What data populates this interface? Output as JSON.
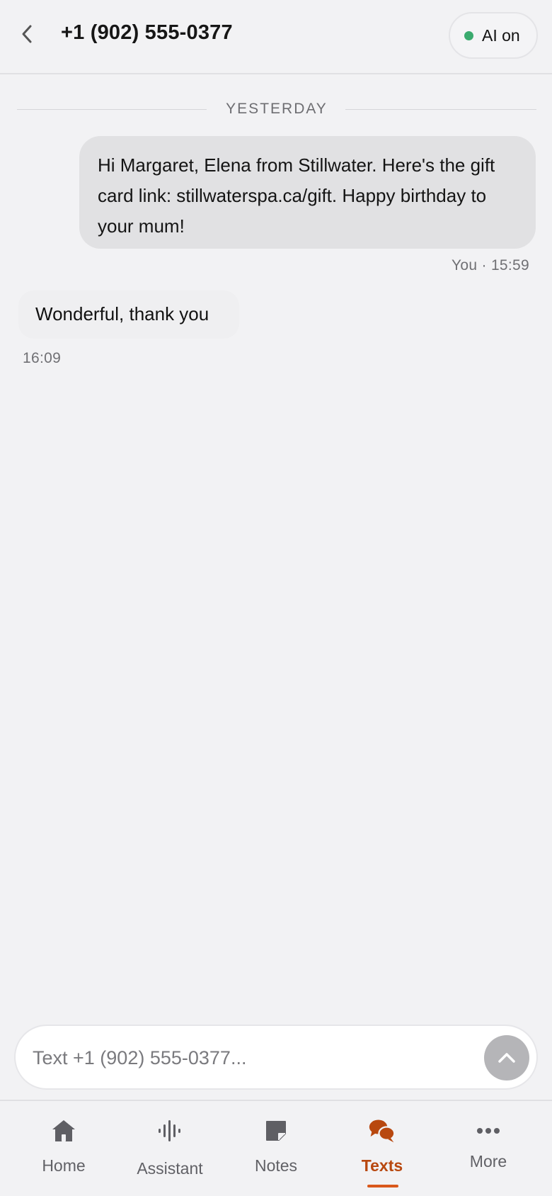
{
  "header": {
    "title": "+1 (902) 555-0377",
    "ai_status": "AI on",
    "ai_status_color": "#3aaa6e"
  },
  "thread": {
    "day_label": "YESTERDAY",
    "messages": [
      {
        "direction": "outgoing",
        "text": "Hi Margaret, Elena from Stillwater. Here's the gift card link: stillwaterspa.ca/gift. Happy birthday to your mum!",
        "meta": "You · 15:59"
      },
      {
        "direction": "incoming",
        "text": "Wonderful, thank you",
        "meta": "16:09"
      }
    ]
  },
  "composer": {
    "placeholder": "Text +1 (902) 555-0377...",
    "value": ""
  },
  "nav": {
    "active_color": "#b8480f",
    "items": [
      {
        "label": "Home",
        "icon": "home-icon"
      },
      {
        "label": "Assistant",
        "icon": "waveform-icon"
      },
      {
        "label": "Notes",
        "icon": "note-icon"
      },
      {
        "label": "Texts",
        "icon": "chat-bubbles-icon",
        "active": true
      },
      {
        "label": "More",
        "icon": "more-dots-icon"
      }
    ]
  }
}
